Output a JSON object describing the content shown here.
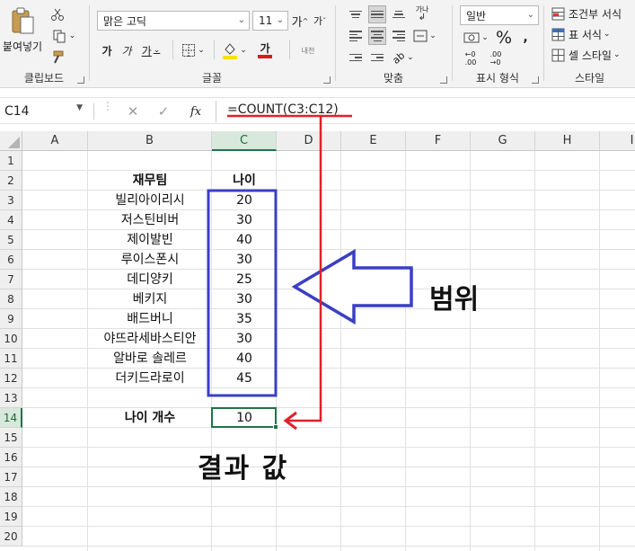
{
  "ribbon": {
    "clipboard": {
      "paste_label": "붙여넣기",
      "group_label": "클립보드"
    },
    "font": {
      "font_name": "맑은 고딕",
      "font_size": "11",
      "grow": "가",
      "shrink": "가",
      "bold": "가",
      "italic": "가",
      "underline": "가",
      "font_color_glyph": "가",
      "phonetic": "내천",
      "group_label": "글꼴"
    },
    "alignment": {
      "group_label": "맞춤",
      "wrap_glyph": "가나"
    },
    "number": {
      "format": "일반",
      "percent": "%",
      "group_label": "표시 형식"
    },
    "styles": {
      "conditional": "조건부 서식",
      "table": "표 서식",
      "cell_style": "셀 스타일",
      "group_label": "스타일"
    }
  },
  "formula_bar": {
    "name_box": "C14",
    "fx": "fx",
    "formula": "=COUNT(C3:C12)"
  },
  "columns": [
    "A",
    "B",
    "C",
    "D",
    "E",
    "F",
    "G",
    "H",
    "I"
  ],
  "rows": [
    "1",
    "2",
    "3",
    "4",
    "5",
    "6",
    "7",
    "8",
    "9",
    "10",
    "11",
    "12",
    "13",
    "14",
    "15",
    "16",
    "17",
    "18",
    "19",
    "20"
  ],
  "sheet": {
    "header_name": "재무팀",
    "header_age": "나이",
    "names": [
      "빌리아이리시",
      "저스틴비버",
      "제이발빈",
      "루이스폰시",
      "데디양키",
      "베키지",
      "배드버니",
      "야뜨라세바스티안",
      "알바로 솔레르",
      "더키드라로이"
    ],
    "ages": [
      "20",
      "30",
      "40",
      "30",
      "25",
      "30",
      "35",
      "30",
      "40",
      "45"
    ],
    "count_label": "나이 개수",
    "count_value": "10"
  },
  "annotations": {
    "range_label": "범위",
    "result_label": "결과 값"
  },
  "colors": {
    "accent_green": "#217346",
    "range_box": "#3a3fc4",
    "arrow_red": "#e0202a"
  }
}
